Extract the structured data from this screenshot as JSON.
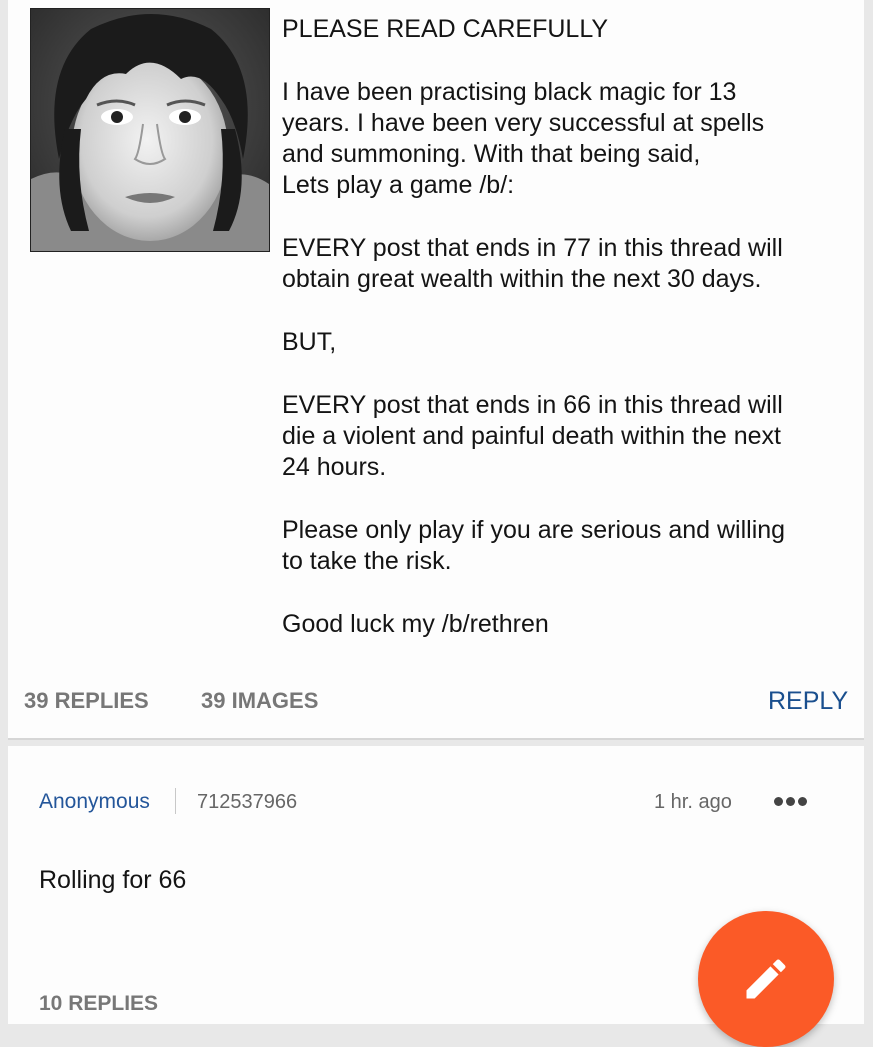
{
  "op": {
    "text": "PLEASE READ CAREFULLY\n\nI have been practising black magic for 13\nyears. I have been very successful at spells\nand summoning. With that being said,\nLets play a game /b/:\n\nEVERY post that ends in 77 in this thread will\nobtain great wealth within the next 30 days.\n\nBUT,\n\nEVERY post that ends in 66 in this thread will\ndie a violent and painful death within the next\n24 hours.\n\nPlease only play if you are serious and willing\nto take the risk.\n\nGood luck my /b/rethren",
    "replies_label": "39 REPLIES",
    "images_label": "39 IMAGES",
    "reply_button": "REPLY"
  },
  "reply_post": {
    "author": "Anonymous",
    "post_number": "712537966",
    "time": "1 hr. ago",
    "text": "Rolling for 66",
    "replies_label": "10 REPLIES"
  },
  "colors": {
    "accent_link": "#24569a",
    "fab": "#fb5a27"
  },
  "icons": {
    "more": "more-horizontal-icon",
    "fab": "pencil-icon"
  }
}
